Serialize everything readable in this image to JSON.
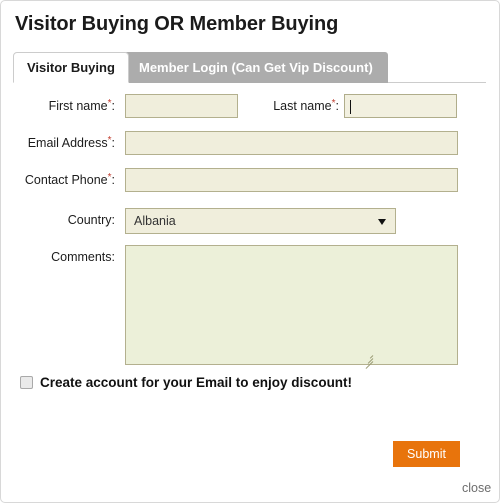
{
  "dialog": {
    "title": "Visitor Buying OR Member Buying",
    "close_label": "close"
  },
  "tabs": [
    {
      "id": "visitor-buying",
      "label": "Visitor Buying",
      "active": true
    },
    {
      "id": "member-login",
      "label": "Member Login (Can Get Vip Discount)",
      "active": false
    }
  ],
  "form": {
    "fields": {
      "first_name": {
        "label": "First name",
        "required_mark": "*",
        "suffix": ":",
        "value": "",
        "placeholder": ""
      },
      "last_name": {
        "label": "Last name",
        "required_mark": "*",
        "suffix": ":",
        "value": "",
        "placeholder": "",
        "focused": true
      },
      "email_address": {
        "label": "Email Address",
        "required_mark": "*",
        "suffix": ":",
        "value": "",
        "placeholder": ""
      },
      "contact_phone": {
        "label": "Contact Phone",
        "required_mark": "*",
        "suffix": ":",
        "value": "",
        "placeholder": ""
      },
      "country": {
        "label": "Country:",
        "selected": "Albania"
      },
      "comments": {
        "label": "Comments:",
        "value": "",
        "placeholder": ""
      }
    },
    "create_account_checkbox": {
      "label": "Create account for your Email to enjoy discount!",
      "checked": false
    },
    "submit_label": "Submit"
  },
  "colors": {
    "accent_orange": "#e8740c",
    "input_bg": "#f0eedc",
    "input_border": "#b3b08e",
    "textarea_bg": "#ecf0d9",
    "inactive_tab_bg": "#acacac",
    "required_asterisk": "#c0392b"
  }
}
